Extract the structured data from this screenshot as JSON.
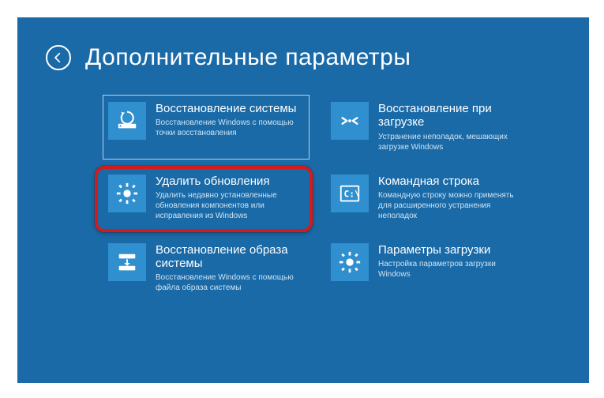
{
  "header": {
    "title": "Дополнительные параметры"
  },
  "tiles": [
    {
      "title": "Восстановление системы",
      "desc": "Восстановление Windows с помощью точки восстановления",
      "icon": "restore-point"
    },
    {
      "title": "Восстановление при загрузке",
      "desc": "Устранение неполадок, мешающих загрузке Windows",
      "icon": "startup-repair"
    },
    {
      "title": "Удалить обновления",
      "desc": "Удалить недавно установленные обновления компонентов или исправления из Windows",
      "icon": "uninstall-updates"
    },
    {
      "title": "Командная строка",
      "desc": "Командную строку можно применять для расширенного устранения неполадок",
      "icon": "command-prompt"
    },
    {
      "title": "Восстановление образа системы",
      "desc": "Восстановление Windows с помощью файла образа системы",
      "icon": "image-recovery"
    },
    {
      "title": "Параметры загрузки",
      "desc": "Настройка параметров загрузки Windows",
      "icon": "startup-settings"
    }
  ]
}
